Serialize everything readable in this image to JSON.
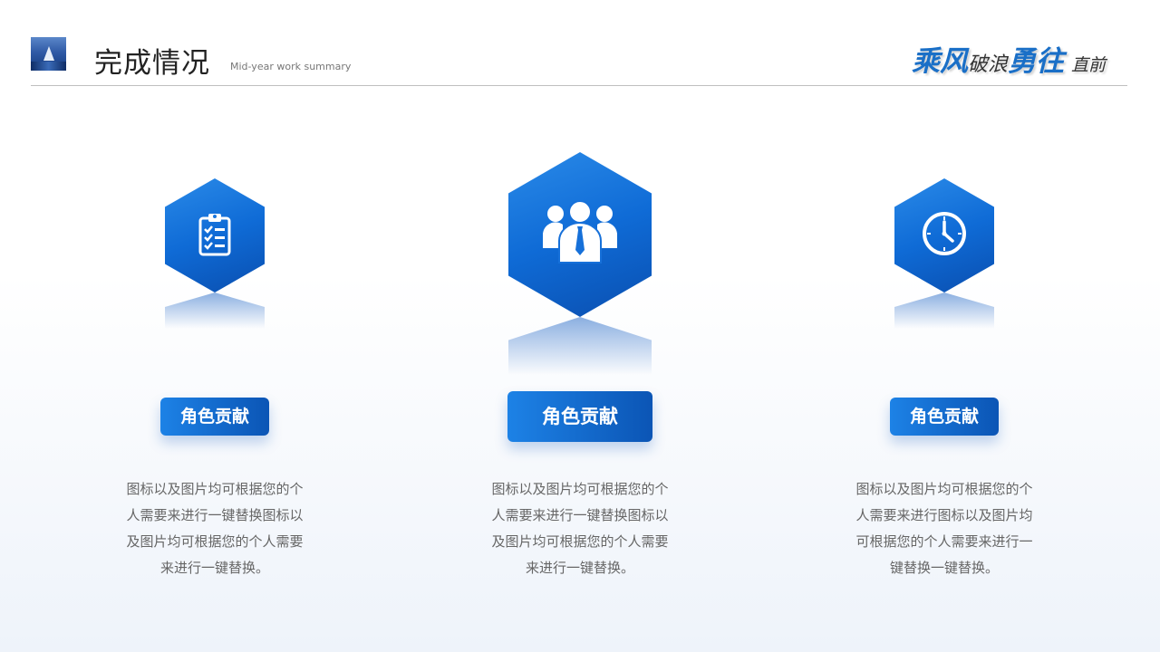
{
  "header": {
    "title": "完成情况",
    "subtitle": "Mid-year work summary",
    "slogan": {
      "part1": "乘风",
      "part2": "破浪",
      "part3": "勇往",
      "part4": "直前"
    }
  },
  "accent_color": "#0f6bd6",
  "cards": [
    {
      "icon": "clipboard-checklist-icon",
      "label": "角色贡献",
      "description": "图标以及图片均可根据您的个人需要来进行一键替换图标以及图片均可根据您的个人需要来进行一键替换。"
    },
    {
      "icon": "team-people-icon",
      "label": "角色贡献",
      "description": "图标以及图片均可根据您的个人需要来进行一键替换图标以及图片均可根据您的个人需要来进行一键替换。"
    },
    {
      "icon": "clock-icon",
      "label": "角色贡献",
      "description": "图标以及图片均可根据您的个人需要来进行图标以及图片均可根据您的个人需要来进行一键替换一键替换。"
    }
  ]
}
